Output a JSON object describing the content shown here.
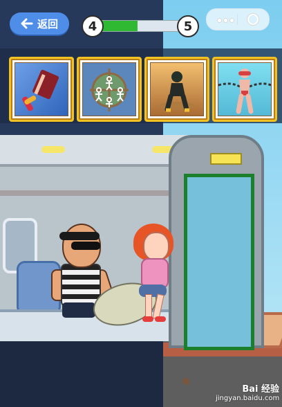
{
  "header": {
    "back_label": "返回",
    "progress": {
      "current_level": "4",
      "next_level": "5",
      "completion": 0.46
    },
    "miniprogram_menu": {
      "more_icon": "more-dots-icon",
      "close_icon": "record-circle-icon"
    }
  },
  "levels": [
    {
      "icon": "red-book-and-hammer-icon"
    },
    {
      "icon": "compass-stick-figures-icon"
    },
    {
      "icon": "desert-soldier-icon"
    },
    {
      "icon": "chained-swimmer-icon"
    }
  ],
  "scene": {
    "title_hidden": "",
    "characters": [
      {
        "name": "villain-character"
      },
      {
        "name": "girl-character"
      }
    ],
    "objects": [
      {
        "name": "loot-bag"
      },
      {
        "name": "train-door"
      },
      {
        "name": "green-door-frame"
      },
      {
        "name": "platform"
      }
    ]
  },
  "watermark": {
    "brand": "Bai  经验",
    "url": "jingyan.baidu.com"
  },
  "colors": {
    "accent_blue": "#4f8ee8",
    "progress_green": "#2fb832",
    "card_gold": "#f1c222",
    "scene_blue": "#27395a"
  }
}
